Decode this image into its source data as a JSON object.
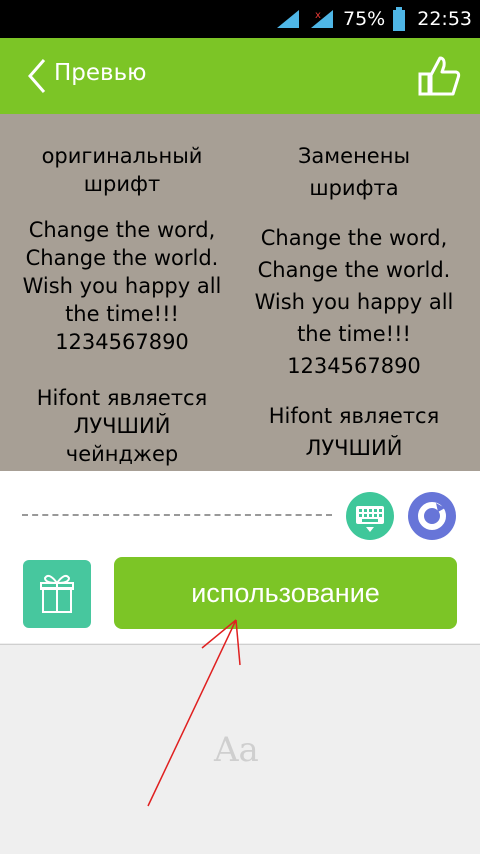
{
  "status_bar": {
    "battery_percent": "75%",
    "time": "22:53"
  },
  "app_bar": {
    "title": "Превью"
  },
  "preview": {
    "original": {
      "header": [
        "оригинальный",
        "шрифт"
      ],
      "sample": [
        "Change the word,",
        "Change the world.",
        "Wish you happy all",
        "the time!!!",
        "1234567890"
      ],
      "tagline": [
        "Hifont является",
        "ЛУЧШИЙ",
        "чейнджер"
      ]
    },
    "replaced": {
      "header": [
        "Заменены",
        "шрифта"
      ],
      "sample": [
        "Change the word,",
        "Change the world.",
        "Wish you happy all",
        "the time!!!",
        "1234567890"
      ],
      "tagline": [
        "Hifont является",
        "ЛУЧШИЙ"
      ]
    }
  },
  "actions": {
    "use_label": "использование"
  },
  "footer": {
    "font_sample": "Aa"
  },
  "colors": {
    "accent": "#7cc526",
    "teal": "#47c79e",
    "purple": "#6775d8"
  },
  "icons": [
    "back-chevron-icon",
    "thumbs-up-icon",
    "keyboard-icon",
    "circle-ring-icon",
    "gift-icon",
    "signal-icon",
    "battery-icon"
  ]
}
